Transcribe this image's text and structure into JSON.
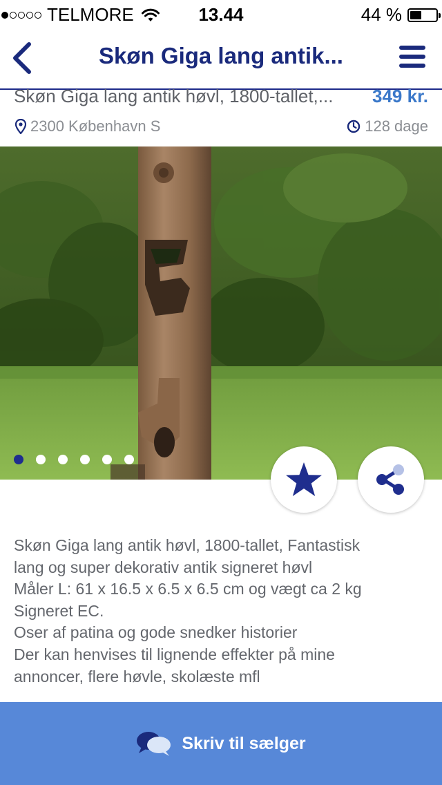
{
  "status_bar": {
    "carrier": "TELMORE",
    "time": "13.44",
    "battery_percent": "44 %",
    "battery_level": 0.44,
    "signal_bars_filled": 1
  },
  "nav": {
    "title": "Skøn Giga lang antik..."
  },
  "listing": {
    "title": "Skøn Giga lang antik høvl, 1800-tallet,...",
    "price": "349 kr.",
    "location": "2300 København S",
    "age": "128 dage"
  },
  "gallery": {
    "image_count": 6,
    "active_index": 0
  },
  "description": {
    "lines": [
      "Skøn Giga lang antik høvl, 1800-tallet, Fantastisk",
      "lang og super dekorativ antik signeret høvl",
      "Måler L: 61 x 16.5 x 6.5 x 6.5 cm og vægt ca 2 kg",
      "Signeret EC.",
      "Oser af patina og gode snedker historier",
      "Der kan henvises til lignende effekter på mine",
      "annoncer, flere høvle, skolæste mfl"
    ]
  },
  "contact": {
    "label": "Skriv til sælger"
  },
  "colors": {
    "brand_navy": "#1a2a7c",
    "price_blue": "#3a78c9",
    "contact_bar": "#5788d8"
  }
}
